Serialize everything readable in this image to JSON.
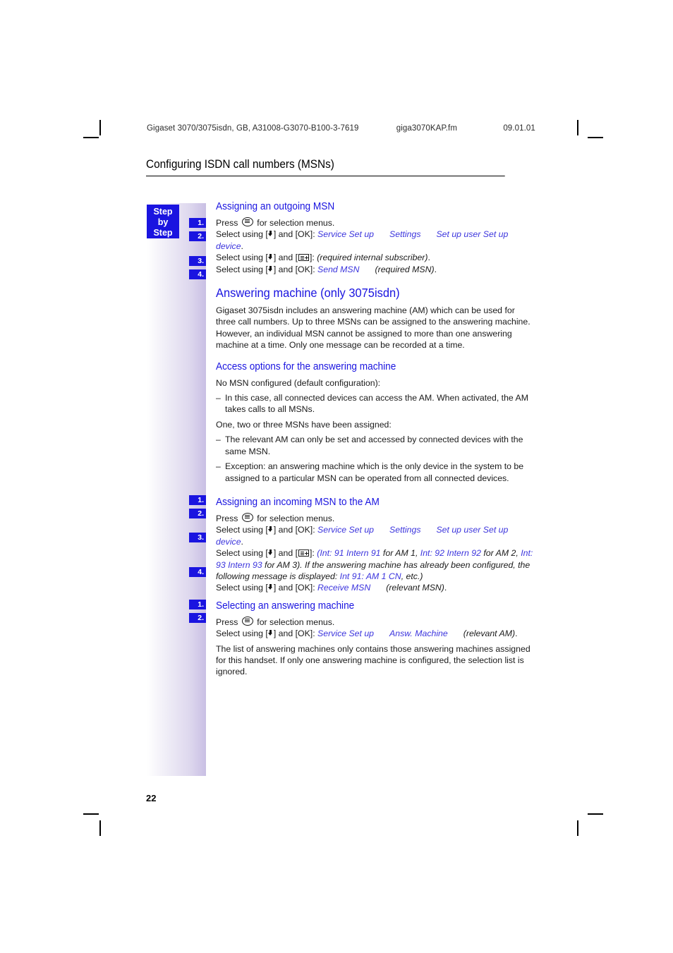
{
  "header": {
    "document_ref": "Gigaset 3070/3075isdn, GB, A31008-G3070-B100-3-7619",
    "file_name": "giga3070KAP.fm",
    "date": "09.01.01"
  },
  "chapter_title": "Configuring ISDN call numbers (MSNs)",
  "sidebar": {
    "step_by_step": {
      "line1": "Step",
      "line2": "by",
      "line3": "Step"
    },
    "badges": [
      "1.",
      "2.",
      "3.",
      "4.",
      "1.",
      "2.",
      "3.",
      "4.",
      "1.",
      "2."
    ]
  },
  "sections": [
    {
      "heading": "Assigning an outgoing MSN",
      "steps": [
        {
          "number": "1.",
          "text_before": "Press",
          "icon": "menu-key-icon",
          "text_after": "for selection menus."
        },
        {
          "number": "2.",
          "lead": "Select using [",
          "mid": "] and [OK]:",
          "menu_path": [
            "Service Set up",
            "Settings",
            "Set up user",
            "Set up device"
          ],
          "trailing": "."
        },
        {
          "number": "3.",
          "lead": "Select using [",
          "mid": "] and [",
          "mid2": "]:",
          "italic_note": "(required internal subscriber)",
          "trailing": "."
        },
        {
          "number": "4.",
          "lead": "Select using [",
          "mid": "] and [OK]:",
          "menu_path": [
            "Send MSN"
          ],
          "italic_note": "(required MSN)",
          "trailing": "."
        }
      ]
    },
    {
      "heading": "Answering machine (only 3075isdn)",
      "body": "Gigaset 3075isdn includes an answering machine (AM) which can be used for three call numbers. Up to three MSNs can be assigned to the answering machine. However, an individual MSN cannot be assigned to more than one answering machine at a time. Only one message can be recorded at a time."
    },
    {
      "heading": "Access options for the answering machine",
      "intro1": "No MSN configured (default configuration):",
      "dash1": "In this case, all connected devices can access the AM. When activated, the AM takes calls to all MSNs.",
      "intro2": "One, two or three MSNs have been assigned:",
      "dash2": "The relevant AM can only be set and accessed by connected devices with the same MSN.",
      "dash3": "Exception: an answering machine which is the only device in the system to be assigned to a particular MSN can be operated from all connected devices.",
      "dash_marker": "–"
    },
    {
      "heading": "Assigning an incoming MSN to the AM",
      "steps": [
        {
          "number": "1.",
          "text_before": "Press",
          "icon": "menu-key-icon",
          "text_after": "for selection menus."
        },
        {
          "number": "2.",
          "lead": "Select using [",
          "mid": "] and [OK]:",
          "menu_path": [
            "Service Set up",
            "Settings",
            "Set up user",
            "Set up device"
          ],
          "trailing": "."
        },
        {
          "number": "3.",
          "lead": "Select using [",
          "mid": "] and [",
          "mid2": "]:",
          "seg_a": "(Int: 91 Intern 91",
          "seg_b": " for AM 1, ",
          "seg_c": "Int: 92 Intern 92",
          "seg_d": " for AM 2, ",
          "seg_e": "Int: 93 Intern 93",
          "seg_f": " for AM 3). If the answering machine has already been configured, the following message is displayed: ",
          "seg_g": "Int 91: AM 1 CN",
          "seg_h": ", etc.)"
        },
        {
          "number": "4.",
          "lead": "Select using [",
          "mid": "] and [OK]:",
          "menu_path": [
            "Receive MSN"
          ],
          "italic_note": "(relevant MSN)",
          "trailing": "."
        }
      ]
    },
    {
      "heading": "Selecting an answering machine",
      "steps": [
        {
          "number": "1.",
          "text_before": "Press",
          "icon": "menu-key-icon",
          "text_after": "for selection menus."
        },
        {
          "number": "2.",
          "lead": "Select using [",
          "mid": "] and [OK]:",
          "menu_path": [
            "Service Set up",
            "Answ. Machine"
          ],
          "italic_note": "(relevant AM)",
          "trailing": "."
        }
      ],
      "body": "The list of answering machines only contains those answering machines assigned for this handset. If only one answering machine is configured, the selection list is ignored."
    }
  ],
  "page_number": "22",
  "colors": {
    "accent_blue": "#1a14e0",
    "menu_path_blue": "#3b34dd",
    "rail_end": "#c9bfe4"
  }
}
